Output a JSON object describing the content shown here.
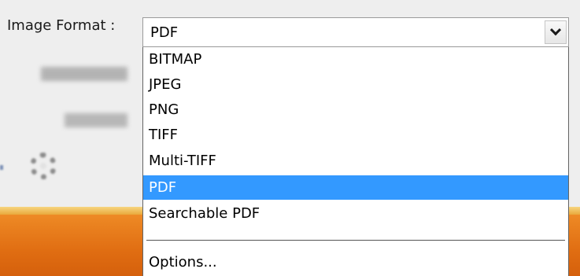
{
  "format_field": {
    "label": "Image Format :",
    "current_value": "PDF"
  },
  "dropdown": {
    "items": [
      "BITMAP",
      "JPEG",
      "PNG",
      "TIFF",
      "Multi-TIFF",
      "PDF",
      "Searchable PDF"
    ],
    "selected_item": "PDF",
    "options_label": "Options..."
  },
  "icons": [
    "chevron-down-icon",
    "gear-icon"
  ],
  "colors": {
    "selection": "#3399ff",
    "footer_orange": "#e06d12",
    "band_gold": "#f2c45c"
  }
}
